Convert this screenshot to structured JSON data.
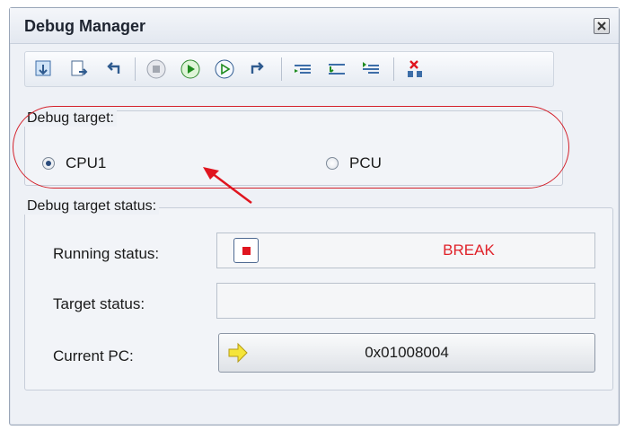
{
  "window": {
    "title": "Debug Manager"
  },
  "toolbar": {
    "buttons": [
      "download-icon",
      "reset-icon",
      "step-back-icon",
      "stop-icon",
      "go-icon",
      "run-icon",
      "return-icon",
      "step-in-icon",
      "step-over-icon",
      "step-out-icon",
      "disconnect-icon"
    ]
  },
  "debug_target": {
    "label": "Debug target:",
    "options": [
      {
        "label": "CPU1",
        "checked": true
      },
      {
        "label": "PCU",
        "checked": false
      }
    ]
  },
  "status": {
    "label": "Debug target status:",
    "running_label": "Running status:",
    "running_value": "BREAK",
    "target_label": "Target status:",
    "target_value": "",
    "pc_label": "Current PC:",
    "pc_value": "0x01008004"
  },
  "colors": {
    "annotation": "#d4212b",
    "break": "#e0222a"
  }
}
